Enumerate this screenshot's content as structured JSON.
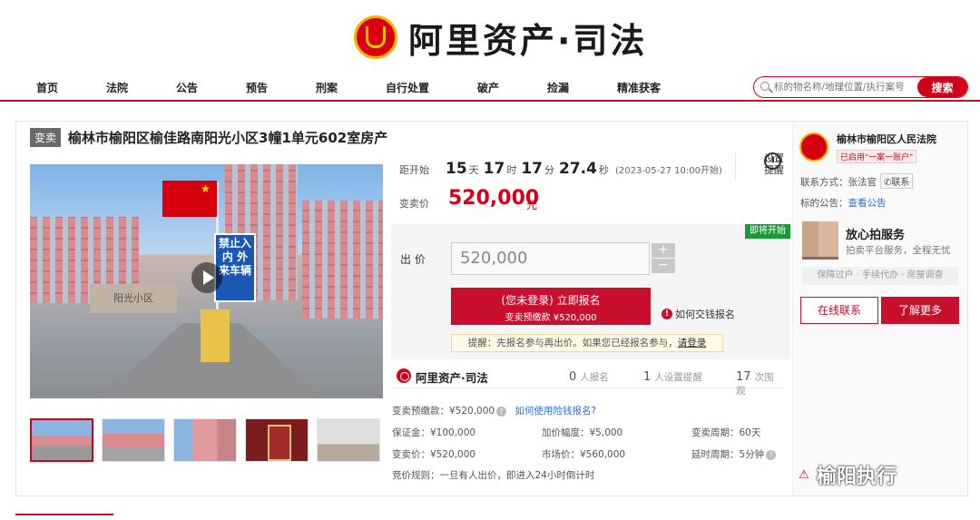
{
  "brand": {
    "logo_text": "阿里资产·司法"
  },
  "nav": [
    "首页",
    "法院",
    "公告",
    "预告",
    "刑案",
    "自行处置",
    "破产",
    "捡漏",
    "精准获客"
  ],
  "search": {
    "placeholder": "标的物名称/地理位置/执行案号",
    "button": "搜索"
  },
  "item": {
    "tag": "变卖",
    "title": "榆林市榆阳区榆佳路南阳光小区3幢1单元602室房产",
    "image_texts": {
      "sign": "禁止入内 外来车辆",
      "gate": "阳光小区"
    }
  },
  "countdown": {
    "label": "距开始",
    "days": "15",
    "days_unit": "天",
    "hours": "17",
    "hours_unit": "时",
    "minutes": "17",
    "minutes_unit": "分",
    "seconds": "27.4",
    "seconds_unit": "秒",
    "start": "(2023-05-27 10:00开始)"
  },
  "remind": {
    "line1": "设置",
    "line2": "提醒"
  },
  "price": {
    "label": "变卖价",
    "value": "520,000",
    "unit": "元"
  },
  "bid": {
    "badge": "即将开始",
    "label": "出 价",
    "value": "520,000",
    "plus": "+",
    "minus": "−",
    "signup_main": "(您未登录) 立即报名",
    "signup_sub": "变卖预缴款 ¥520,000",
    "how": "如何交钱报名",
    "tip_text": "提醒：先报名参与再出价。如果您已经报名参与，",
    "tip_link": "请登录"
  },
  "stats": {
    "brand": "阿里资产·司法",
    "signups": "0",
    "signups_label": "人报名",
    "reminders": "1",
    "reminders_label": "人设置提醒",
    "views": "17",
    "views_label": "次围观"
  },
  "details": {
    "deposit_pre": "变卖预缴款：¥520,000",
    "deposit_link": "如何使用险钱报名?",
    "margin": "保证金：¥100,000",
    "increment": "加价幅度：¥5,000",
    "period": "变卖周期：60天",
    "sale_price": "变卖价：¥520,000",
    "market_price": "市场价：¥560,000",
    "delay": "延时周期：5分钟",
    "rule": "竞价规则：一旦有人出价，即进入24小时倒计时"
  },
  "court": {
    "name": "榆林市榆阳区人民法院",
    "verified": "已启用\"一案一账户\"",
    "contact_label": "联系方式：",
    "contact_name": "张法官",
    "contact_btn": "联系",
    "notice_label": "标的公告：",
    "notice_link": "查看公告"
  },
  "service": {
    "title": "放心拍服务",
    "sub": "拍卖平台服务，全程无忧",
    "bar": "保障过户 · 手续代办 · 房屋调查",
    "btn_online": "在线联系",
    "btn_more": "了解更多"
  },
  "watermark": "榆阳执行",
  "colors": {
    "accent": "#c8102e",
    "green": "#1a9b3a",
    "link": "#2f6ed7"
  }
}
